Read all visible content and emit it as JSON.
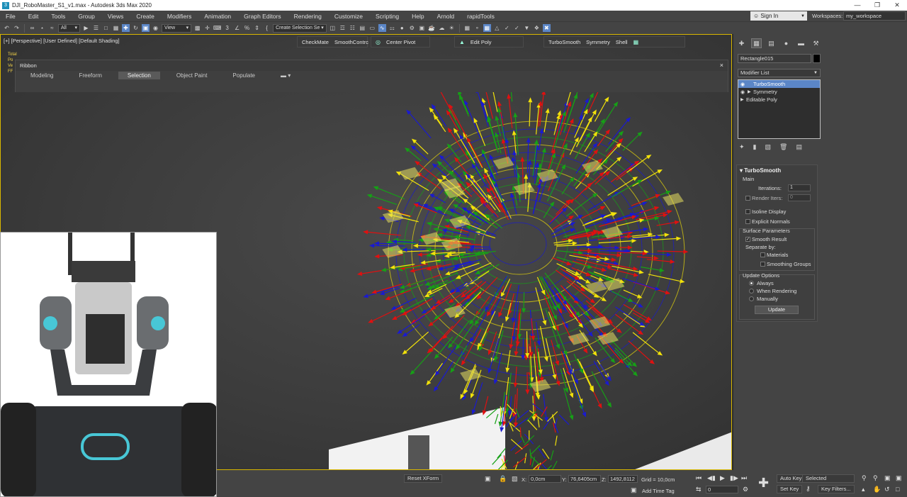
{
  "window": {
    "title": "DJI_RoboMaster_S1_v1.max - Autodesk 3ds Max 2020",
    "app_icon": "3"
  },
  "menu": [
    "File",
    "Edit",
    "Tools",
    "Group",
    "Views",
    "Create",
    "Modifiers",
    "Animation",
    "Graph Editors",
    "Rendering",
    "Customize",
    "Scripting",
    "Help",
    "Arnold",
    "rapidTools"
  ],
  "account": {
    "sign_in": "Sign In",
    "workspaces_label": "Workspaces:",
    "workspace": "my_workspace"
  },
  "toolbar": {
    "selection_filter": "All",
    "reference_coord": "View",
    "named_selection": "Create Selection Se",
    "percent_snap": "%"
  },
  "viewport": {
    "label": "[+] [Perspective] [User Defined] [Default Shading]",
    "stats_lines": [
      "Total",
      "Po",
      "Ve",
      "FF"
    ]
  },
  "quad_buttons": {
    "checkmate": "CheckMate",
    "smooth": "SmoothContrc",
    "center_pivot": "Center Pivot",
    "edit_poly": "Edit Poly",
    "turbosmooth": "TurboSmooth",
    "symmetry": "Symmetry",
    "shell": "Shell"
  },
  "ribbon": {
    "title": "Ribbon",
    "close": "×",
    "tabs": [
      {
        "label": "Modeling",
        "active": false
      },
      {
        "label": "Freeform",
        "active": false
      },
      {
        "label": "Selection",
        "active": true
      },
      {
        "label": "Object Paint",
        "active": false
      },
      {
        "label": "Populate",
        "active": false
      }
    ]
  },
  "command_panel": {
    "object_name": "Rectangle015",
    "object_color": "#000000",
    "modifier_list": "Modifier List",
    "stack": [
      {
        "label": "TurboSmooth",
        "selected": true,
        "has_arrow": false
      },
      {
        "label": "Symmetry",
        "selected": false,
        "has_arrow": true
      },
      {
        "label": "Editable Poly",
        "selected": false,
        "has_arrow": true
      }
    ],
    "turbosmooth": {
      "title": "TurboSmooth",
      "main_label": "Main",
      "iterations_label": "Iterations:",
      "iterations": "1",
      "render_iters_label": "Render Iters:",
      "render_iters": "0",
      "isoline_display": "Isoline Display",
      "explicit_normals": "Explicit Normals",
      "surface_params": "Surface Parameters",
      "smooth_result": "Smooth Result",
      "separate_by": "Separate by:",
      "materials": "Materials",
      "smoothing_groups": "Smoothing Groups",
      "update_options": "Update Options",
      "always": "Always",
      "when_rendering": "When Rendering",
      "manually": "Manually",
      "update_button": "Update"
    }
  },
  "status": {
    "reset_xform": "Reset XForm",
    "x_label": "X:",
    "x": "0,0cm",
    "y_label": "Y:",
    "y": "76,6405cm",
    "z_label": "Z:",
    "z": "1492,8112",
    "grid": "Grid = 10,0cm",
    "add_time_tag": "Add Time Tag",
    "auto_key": "Auto Key",
    "set_key": "Set Key",
    "selected": "Selected",
    "key_filters": "Key Filters...",
    "frame": "0"
  },
  "colors": {
    "accent": "#5b86c7",
    "viewport_border": "#d9b700"
  }
}
